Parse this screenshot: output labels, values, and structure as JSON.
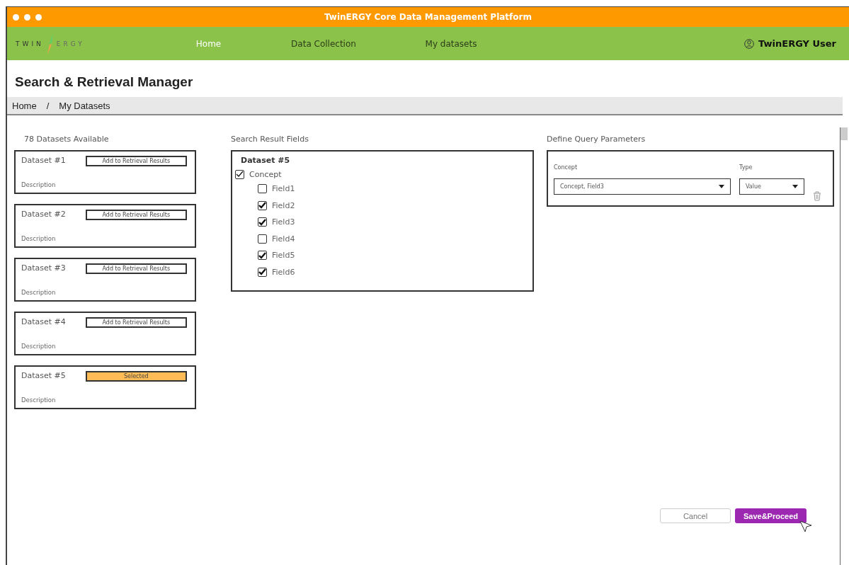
{
  "window": {
    "title": "TwinERGY Core Data Management Platform"
  },
  "nav": {
    "logo": {
      "left": "TWIN",
      "right": "ERGY"
    },
    "items": [
      {
        "label": "Home",
        "selected": true
      },
      {
        "label": "Data Collection",
        "selected": false
      },
      {
        "label": "My datasets",
        "selected": false
      }
    ],
    "user": "TwinERGY User"
  },
  "page_title": "Search & Retrieval Manager",
  "breadcrumb": {
    "items": [
      "Home",
      "My Datasets"
    ],
    "separator": "/"
  },
  "datasets": {
    "heading": "78 Datasets Available",
    "items": [
      {
        "name": "Dataset #1",
        "description": "Description",
        "button": "Add to Retrieval Results",
        "selected": false
      },
      {
        "name": "Dataset #2",
        "description": "Description",
        "button": "Add to Retrieval Results",
        "selected": false
      },
      {
        "name": "Dataset #3",
        "description": "Description",
        "button": "Add to Retrieval Results",
        "selected": false
      },
      {
        "name": "Dataset #4",
        "description": "Description",
        "button": "Add to Retrieval Results",
        "selected": false
      },
      {
        "name": "Dataset #5",
        "description": "Description",
        "button": "Selected",
        "selected": true
      }
    ]
  },
  "result_fields": {
    "heading": "Search Result Fields",
    "dataset": "Dataset #5",
    "concept": {
      "label": "Concept",
      "checked": true,
      "children": [
        {
          "label": "Field1",
          "checked": false
        },
        {
          "label": "Field2",
          "checked": true
        },
        {
          "label": "Field3",
          "checked": true
        },
        {
          "label": "Field4",
          "checked": false
        },
        {
          "label": "Field5",
          "checked": true
        },
        {
          "label": "Field6",
          "checked": true
        }
      ]
    }
  },
  "query": {
    "heading": "Define Query Parameters",
    "concept_label": "Concept",
    "type_label": "Type",
    "concept_value": "Concept, Field3",
    "type_value": "Value"
  },
  "buttons": {
    "cancel": "Cancel",
    "proceed": "Save&Proceed"
  }
}
